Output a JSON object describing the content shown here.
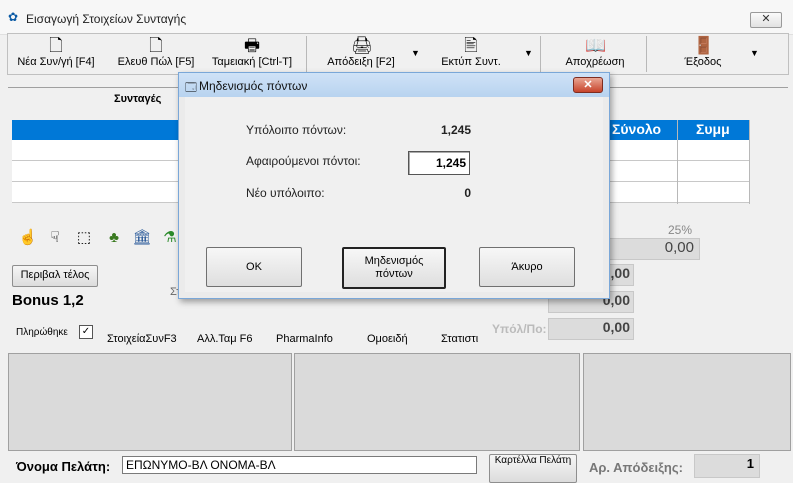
{
  "window": {
    "title": "Εισαγωγή Στοιχείων Συνταγής",
    "close_label": "✕"
  },
  "toolbar": {
    "items": [
      {
        "label": "Νέα Συν/γή [F4]",
        "icon": "new-document-icon"
      },
      {
        "label": "Ελευθ Πώλ [F5]",
        "icon": "document-icon"
      },
      {
        "label": "Ταμειακή [Ctrl-T]",
        "icon": "cash-register-icon"
      },
      {
        "label": "Απόδειξη [F2]",
        "icon": "printer-icon"
      },
      {
        "label": "Εκτύπ Συντ.",
        "icon": "print-prescription-icon"
      },
      {
        "label": "Αποχρέωση",
        "icon": "book-icon"
      },
      {
        "label": "Έξοδος",
        "icon": "exit-door-icon"
      }
    ]
  },
  "main": {
    "tab_label": "Συνταγές",
    "grid_headers": [
      "Σύνολο",
      "Συμμ"
    ],
    "percent_label": "25%",
    "value_top": "0,00",
    "totals": [
      "0,00",
      "0,00",
      "0,00"
    ],
    "fee_button": "Περιβαλ τέλος",
    "bonus_label": "Bonus 1,2",
    "paid_label": "Πληρώθηκε",
    "paid_check": "✓",
    "partial_left_label": "Στ",
    "partial_paid_label": "Υπόλ/Πο:",
    "bottom_tabs": [
      "ΣτοιχείαΣυνF3",
      "Αλλ.Ταμ F6",
      "PharmaInfo",
      "Ομοειδή",
      "Στατιστι"
    ]
  },
  "footer": {
    "customer_label": "Όνομα Πελάτη:",
    "customer_value": "ΕΠΩΝΥΜΟ-ΒΛ ΟΝΟΜΑ-ΒΛ",
    "card_button": "Καρτέλλα Πελάτη",
    "receipt_label": "Αρ. Απόδειξης:",
    "receipt_value": "1"
  },
  "dialog": {
    "title": "Μηδενισμός πόντων",
    "close_label": "✕",
    "remaining_label": "Υπόλοιπο πόντων:",
    "remaining_value": "1,245",
    "deduct_label": "Αφαιρούμενοι πόντοι:",
    "deduct_value": "1,245",
    "new_balance_label": "Νέο υπόλοιπο:",
    "new_balance_value": "0",
    "ok_button": "OK",
    "zero_button": "Μηδενισμός πόντων",
    "cancel_button": "Άκυρο"
  }
}
